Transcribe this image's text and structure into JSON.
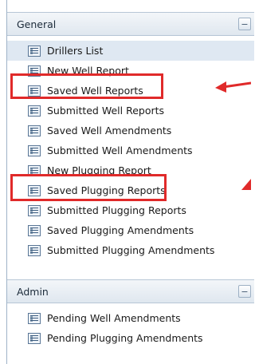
{
  "panels": {
    "general": {
      "title": "General",
      "collapse_glyph": "−",
      "items": [
        {
          "label": "Drillers List",
          "icon": "report-icon"
        },
        {
          "label": "New Well Report",
          "icon": "report-icon"
        },
        {
          "label": "Saved Well Reports",
          "icon": "report-icon"
        },
        {
          "label": "Submitted Well Reports",
          "icon": "report-icon"
        },
        {
          "label": "Saved Well Amendments",
          "icon": "report-icon"
        },
        {
          "label": "Submitted Well Amendments",
          "icon": "report-icon"
        },
        {
          "label": "New Plugging Report",
          "icon": "report-icon"
        },
        {
          "label": "Saved Plugging Reports",
          "icon": "report-icon"
        },
        {
          "label": "Submitted Plugging Reports",
          "icon": "report-icon"
        },
        {
          "label": "Saved Plugging Amendments",
          "icon": "report-icon"
        },
        {
          "label": "Submitted Plugging Amendments",
          "icon": "report-icon"
        }
      ]
    },
    "admin": {
      "title": "Admin",
      "collapse_glyph": "−",
      "items": [
        {
          "label": "Pending Well Amendments",
          "icon": "report-icon"
        },
        {
          "label": "Pending Plugging Amendments",
          "icon": "report-icon"
        }
      ]
    }
  },
  "annotations": {
    "color": "#e02a2a",
    "highlighted_items": [
      "Saved Well Reports",
      "Saved Plugging Reports"
    ]
  }
}
